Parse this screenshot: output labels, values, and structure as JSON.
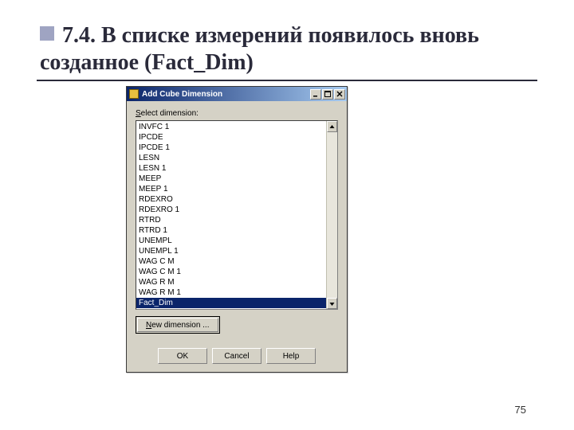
{
  "slide": {
    "heading": "7.4. В списке измерений появилось вновь созданное (Fact_Dim)",
    "page_number": "75"
  },
  "dialog": {
    "title": "Add Cube Dimension",
    "select_label_before": "S",
    "select_label_after": "elect dimension:",
    "items": [
      "INVFC 1",
      "IPCDE",
      "IPCDE 1",
      "LESN",
      "LESN 1",
      "MEEP",
      "MEEP 1",
      "RDEXRO",
      "RDEXRO 1",
      "RTRD",
      "RTRD 1",
      "UNEMPL",
      "UNEMPL 1",
      "WAG C M",
      "WAG C M 1",
      "WAG R M",
      "WAG R M 1",
      "Fact_Dim"
    ],
    "selected_index": 17,
    "new_dim_before": "N",
    "new_dim_after": "ew dimension ...",
    "ok": "OK",
    "cancel": "Cancel",
    "help": "Help"
  }
}
